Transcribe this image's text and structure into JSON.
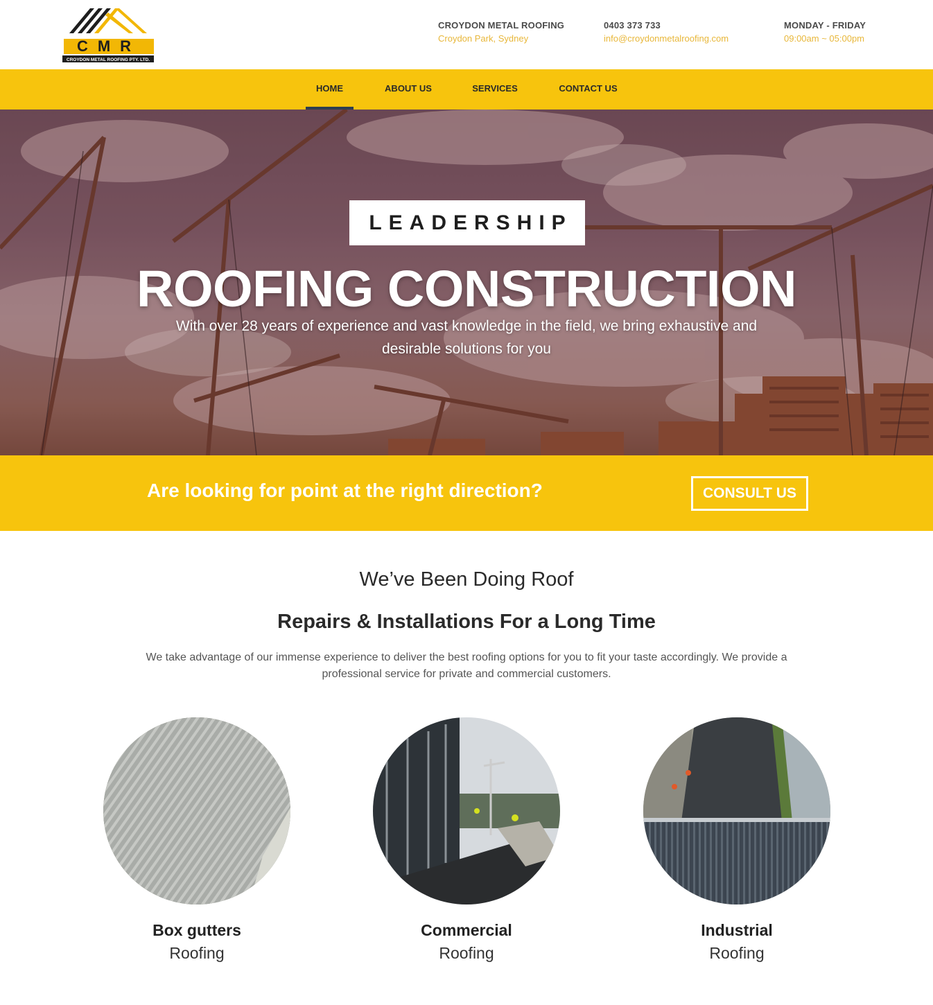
{
  "header": {
    "logo_text": "CMR",
    "logo_caption": "CROYDON METAL ROOFING PTY. LTD.",
    "company": {
      "title": "CROYDON METAL ROOFING",
      "sub": "Croydon Park, Sydney"
    },
    "phone": {
      "title": "0403 373 733",
      "sub": "info@croydonmetalroofing.com"
    },
    "hours": {
      "title": "MONDAY - FRIDAY",
      "sub": "09:00am ~ 05:00pm"
    }
  },
  "nav": {
    "items": [
      {
        "label": "HOME",
        "active": true
      },
      {
        "label": "ABOUT US",
        "active": false
      },
      {
        "label": "SERVICES",
        "active": false
      },
      {
        "label": "CONTACT US",
        "active": false
      }
    ]
  },
  "hero": {
    "badge": "LEADERSHIP",
    "title": "ROOFING CONSTRUCTION",
    "text": "With over 28 years of experience and vast knowledge in the field, we bring exhaustive and desirable solutions for you"
  },
  "cta": {
    "text": "Are looking for point at the right direction?",
    "button": "CONSULT US"
  },
  "intro": {
    "line1": "We’ve Been Doing Roof",
    "line2": "Repairs & Installations For a Long Time",
    "body": "We take advantage of our immense experience to deliver the best roofing options for you to fit your taste accordingly. We provide a professional service for private and commercial customers."
  },
  "services": [
    {
      "title": "Box gutters",
      "sub": "Roofing"
    },
    {
      "title": "Commercial",
      "sub": "Roofing"
    },
    {
      "title": "Industrial",
      "sub": "Roofing"
    }
  ],
  "colors": {
    "brand_yellow": "#f7c40d",
    "nav_active": "#2d3e50",
    "info_accent": "#e8b73a"
  }
}
